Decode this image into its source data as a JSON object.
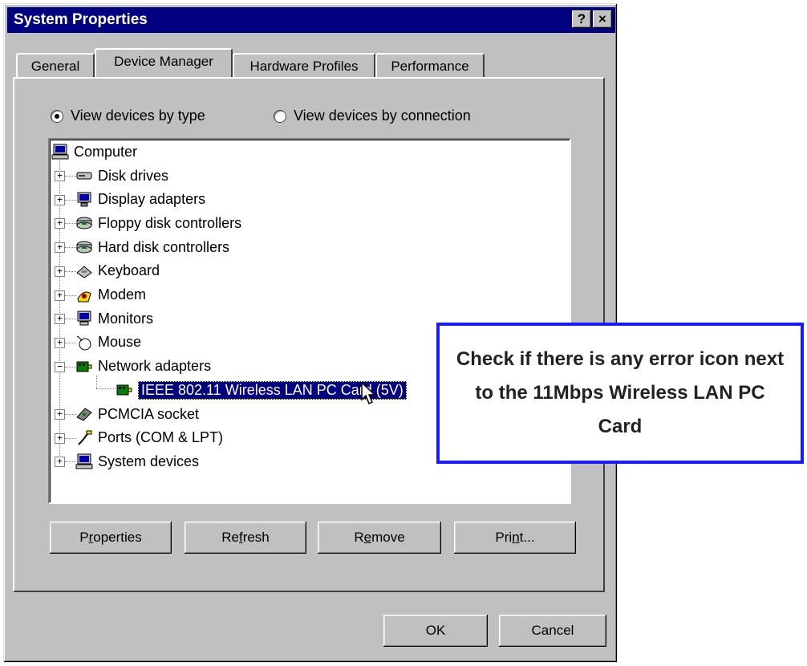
{
  "window": {
    "title": "System Properties",
    "help_button": "?",
    "close_button": "×"
  },
  "tabs": [
    {
      "label": "General"
    },
    {
      "label": "Device Manager",
      "active": true
    },
    {
      "label": "Hardware Profiles"
    },
    {
      "label": "Performance"
    }
  ],
  "view_options": {
    "by_type": {
      "label": "View devices by type",
      "selected": true
    },
    "by_connection": {
      "label": "View devices by connection",
      "selected": false
    }
  },
  "tree": {
    "root": "Computer",
    "items": [
      {
        "label": "Disk drives",
        "icon": "disk-drive-icon",
        "expander": "+"
      },
      {
        "label": "Display adapters",
        "icon": "display-adapter-icon",
        "expander": "+"
      },
      {
        "label": "Floppy disk controllers",
        "icon": "floppy-controller-icon",
        "expander": "+"
      },
      {
        "label": "Hard disk controllers",
        "icon": "hard-disk-controller-icon",
        "expander": "+"
      },
      {
        "label": "Keyboard",
        "icon": "keyboard-icon",
        "expander": "+"
      },
      {
        "label": "Modem",
        "icon": "modem-icon",
        "expander": "+"
      },
      {
        "label": "Monitors",
        "icon": "monitor-icon",
        "expander": "+"
      },
      {
        "label": "Mouse",
        "icon": "mouse-icon",
        "expander": "+"
      },
      {
        "label": "Network adapters",
        "icon": "network-adapter-icon",
        "expander": "−"
      },
      {
        "label": "IEEE 802.11 Wireless LAN PC Card (5V)",
        "icon": "network-card-icon",
        "child": true,
        "selected": true
      },
      {
        "label": "PCMCIA socket",
        "icon": "pcmcia-icon",
        "expander": "+"
      },
      {
        "label": "Ports (COM & LPT)",
        "icon": "port-icon",
        "expander": "+"
      },
      {
        "label": "System devices",
        "icon": "system-devices-icon",
        "expander": "+"
      }
    ]
  },
  "buttons": {
    "properties": {
      "pre": "P",
      "u": "r",
      "post": "operties"
    },
    "refresh": {
      "pre": "Re",
      "u": "f",
      "post": "resh"
    },
    "remove": {
      "pre": "R",
      "u": "e",
      "post": "move"
    },
    "print": {
      "pre": "Pri",
      "u": "n",
      "post": "t..."
    },
    "ok": "OK",
    "cancel": "Cancel"
  },
  "callout": {
    "text": "Check if there is any error icon next to the 11Mbps Wireless LAN PC Card"
  },
  "colors": {
    "titlebar": "#000080",
    "face": "#c0c0c0",
    "callout_border": "#1a1aff"
  }
}
